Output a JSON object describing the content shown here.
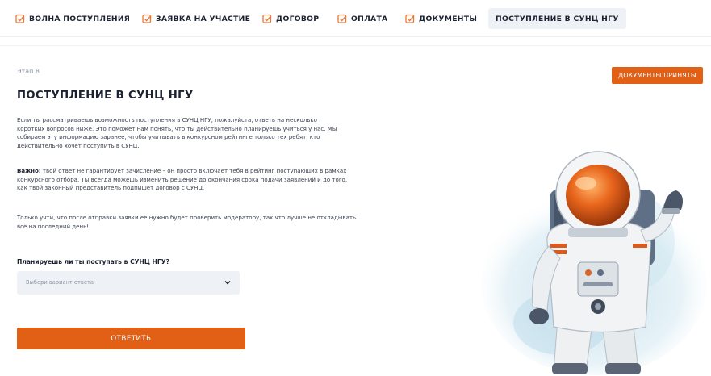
{
  "tabs": [
    {
      "label": "ВОЛНА ПОСТУПЛЕНИЯ",
      "completed": true
    },
    {
      "label": "ЗАЯВКА НА УЧАСТИЕ",
      "completed": true
    },
    {
      "label": "ДОГОВОР",
      "completed": true
    },
    {
      "label": "ОПЛАТА",
      "completed": true
    },
    {
      "label": "ДОКУМЕНТЫ",
      "completed": true
    },
    {
      "label": "ПОСТУПЛЕНИЕ В СУНЦ НГУ",
      "completed": false,
      "active": true
    }
  ],
  "stage_label": "Этап 8",
  "status_button": "ДОКУМЕНТЫ ПРИНЯТЫ",
  "title": "ПОСТУПЛЕНИЕ В СУНЦ НГУ",
  "intro": "Если ты рассматриваешь возможность поступления в СУНЦ НГУ, пожалуйста, ответь на несколько коротких вопросов ниже. Это поможет нам понять, что ты действительно планируешь учиться у нас. Мы собираем эту информацию заранее, чтобы учитывать в конкурсном рейтинге только тех ребят, кто действительно хочет поступить в СУНЦ.",
  "important_label": "Важно:",
  "important_text": " твой ответ не гарантирует зачисление – он просто включает тебя в рейтинг поступающих в рамках конкурсного отбора. Ты всегда можешь изменить решение до окончания срока подачи заявлений и до того, как твой законный представитель подпишет договор с СУНЦ.",
  "moderation_note": "Только учти, что после отправки заявки её нужно будет проверить модератору, так что лучше не откладывать всё на последний день!",
  "question": {
    "label": "Планируешь ли ты поступать в СУНЦ НГУ?",
    "placeholder": "Выбери вариант ответа"
  },
  "submit_label": "ОТВЕТИТЬ",
  "colors": {
    "accent": "#e25f16",
    "text": "#1b2130",
    "muted": "#8e95a3",
    "field_bg": "#eef1f6"
  },
  "illustration": "astronaut-watercolor"
}
